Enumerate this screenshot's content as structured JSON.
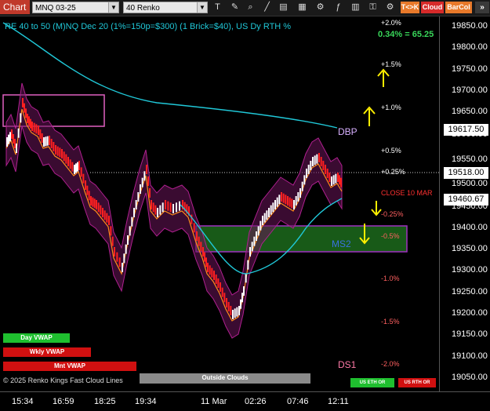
{
  "toolbar": {
    "tab": "Chart",
    "instrument": "MNQ 03-25",
    "bar_type": "40 Renko",
    "buttons": [
      "T<>K",
      "Cloud",
      "BarCol"
    ]
  },
  "chart": {
    "title": "RE 40 to 50 (M)NQ Dec 20 (1%=150p=$300) (1 Brick=$40), US Dy RTH %",
    "pct_change": "0.34% = 65.25",
    "levels": [
      {
        "label": "+2.0%",
        "color": "#ff7aa8"
      },
      {
        "label": "+1.5%",
        "color": "#ffffff"
      },
      {
        "label": "+1.0%",
        "color": "#ffffff"
      },
      {
        "label": "+0.5%",
        "color": "#ffffff"
      },
      {
        "label": "+0.25%",
        "color": "#ffffff"
      },
      {
        "label": "CLOSE 10 MAR",
        "color": "#ff3030"
      },
      {
        "label": "-0.25%",
        "color": "#ff6060"
      },
      {
        "label": "-0.5%",
        "color": "#ff6060"
      },
      {
        "label": "-1.0%",
        "color": "#ff6060"
      },
      {
        "label": "-1.5%",
        "color": "#ff6060"
      },
      {
        "label": "-2.0%",
        "color": "#ff6060"
      }
    ],
    "annotations": {
      "dbp": "DBP",
      "ms2": "MS2",
      "ds1": "DS1"
    },
    "vwap_labels": {
      "day": "Day VWAP",
      "weekly": "Wkly VWAP",
      "monthly": "Mnt VWAP"
    },
    "outside_clouds": "Outside Clouds",
    "us_eth_or": "US ETH OR",
    "us_rth_or": "US RTH OR",
    "copyright": "© 2025 Renko Kings Fast Cloud Lines"
  },
  "price_axis": {
    "labels": [
      "19850.00",
      "19800.00",
      "19750.00",
      "19700.00",
      "19650.00",
      "19600.00",
      "19550.00",
      "19500.00",
      "19450.00",
      "19400.00",
      "19350.00",
      "19300.00",
      "19250.00",
      "19200.00",
      "19150.00",
      "19100.00",
      "19050.00"
    ],
    "tags": [
      {
        "value": "19617.50",
        "bg": "#ffffff",
        "fg": "#000000"
      },
      {
        "value": "19518.00",
        "bg": "#ffffff",
        "fg": "#000000"
      },
      {
        "value": "19460.67",
        "bg": "#ffffff",
        "fg": "#000000"
      }
    ]
  },
  "time_axis": {
    "labels": [
      "15:34",
      "16:59",
      "18:25",
      "19:34",
      "11 Mar",
      "02:26",
      "07:46",
      "12:11"
    ]
  },
  "colors": {
    "accent": "#20c8d8",
    "up": "#ffffff",
    "down": "#ff2020",
    "cloud": "#8a1a6a"
  }
}
